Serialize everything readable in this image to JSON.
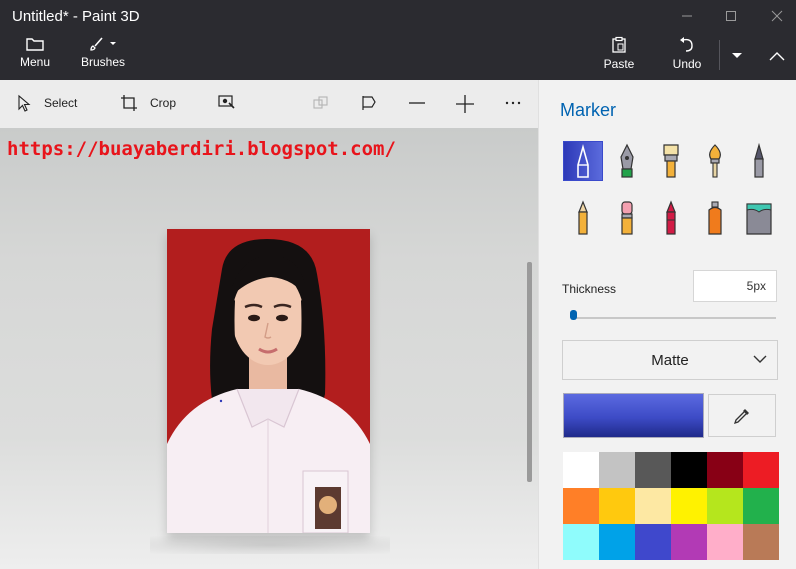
{
  "window": {
    "title": "Untitled* - Paint 3D"
  },
  "ribbon": {
    "menu_label": "Menu",
    "brushes_label": "Brushes",
    "paste_label": "Paste",
    "undo_label": "Undo"
  },
  "toolbar": {
    "select_label": "Select",
    "crop_label": "Crop"
  },
  "canvas": {
    "overlay_url": "https://buayaberdiri.blogspot.com/",
    "photo_background_color": "#b21e1e"
  },
  "panel": {
    "title": "Marker",
    "brushes": [
      {
        "name": "marker-icon",
        "selected": true
      },
      {
        "name": "calligraphy-pen-icon",
        "selected": false
      },
      {
        "name": "oil-brush-icon",
        "selected": false
      },
      {
        "name": "watercolor-icon",
        "selected": false
      },
      {
        "name": "pixel-pen-icon",
        "selected": false
      },
      {
        "name": "pencil-icon",
        "selected": false
      },
      {
        "name": "eraser-icon",
        "selected": false
      },
      {
        "name": "crayon-icon",
        "selected": false
      },
      {
        "name": "spray-can-icon",
        "selected": false
      },
      {
        "name": "fill-bucket-icon",
        "selected": false
      }
    ],
    "thickness_label": "Thickness",
    "thickness_value": "5px",
    "finish_value": "Matte",
    "current_color": "#3d4bc6",
    "palette": [
      "#ffffff",
      "#c3c3c3",
      "#585858",
      "#000000",
      "#880015",
      "#ed1c24",
      "#ff7f27",
      "#ffc90e",
      "#fde8a3",
      "#fff200",
      "#b5e61d",
      "#22b14c",
      "#8ffcfc",
      "#00a2e8",
      "#3f48cc",
      "#b23ab5",
      "#ffaec9",
      "#b97a57"
    ]
  }
}
